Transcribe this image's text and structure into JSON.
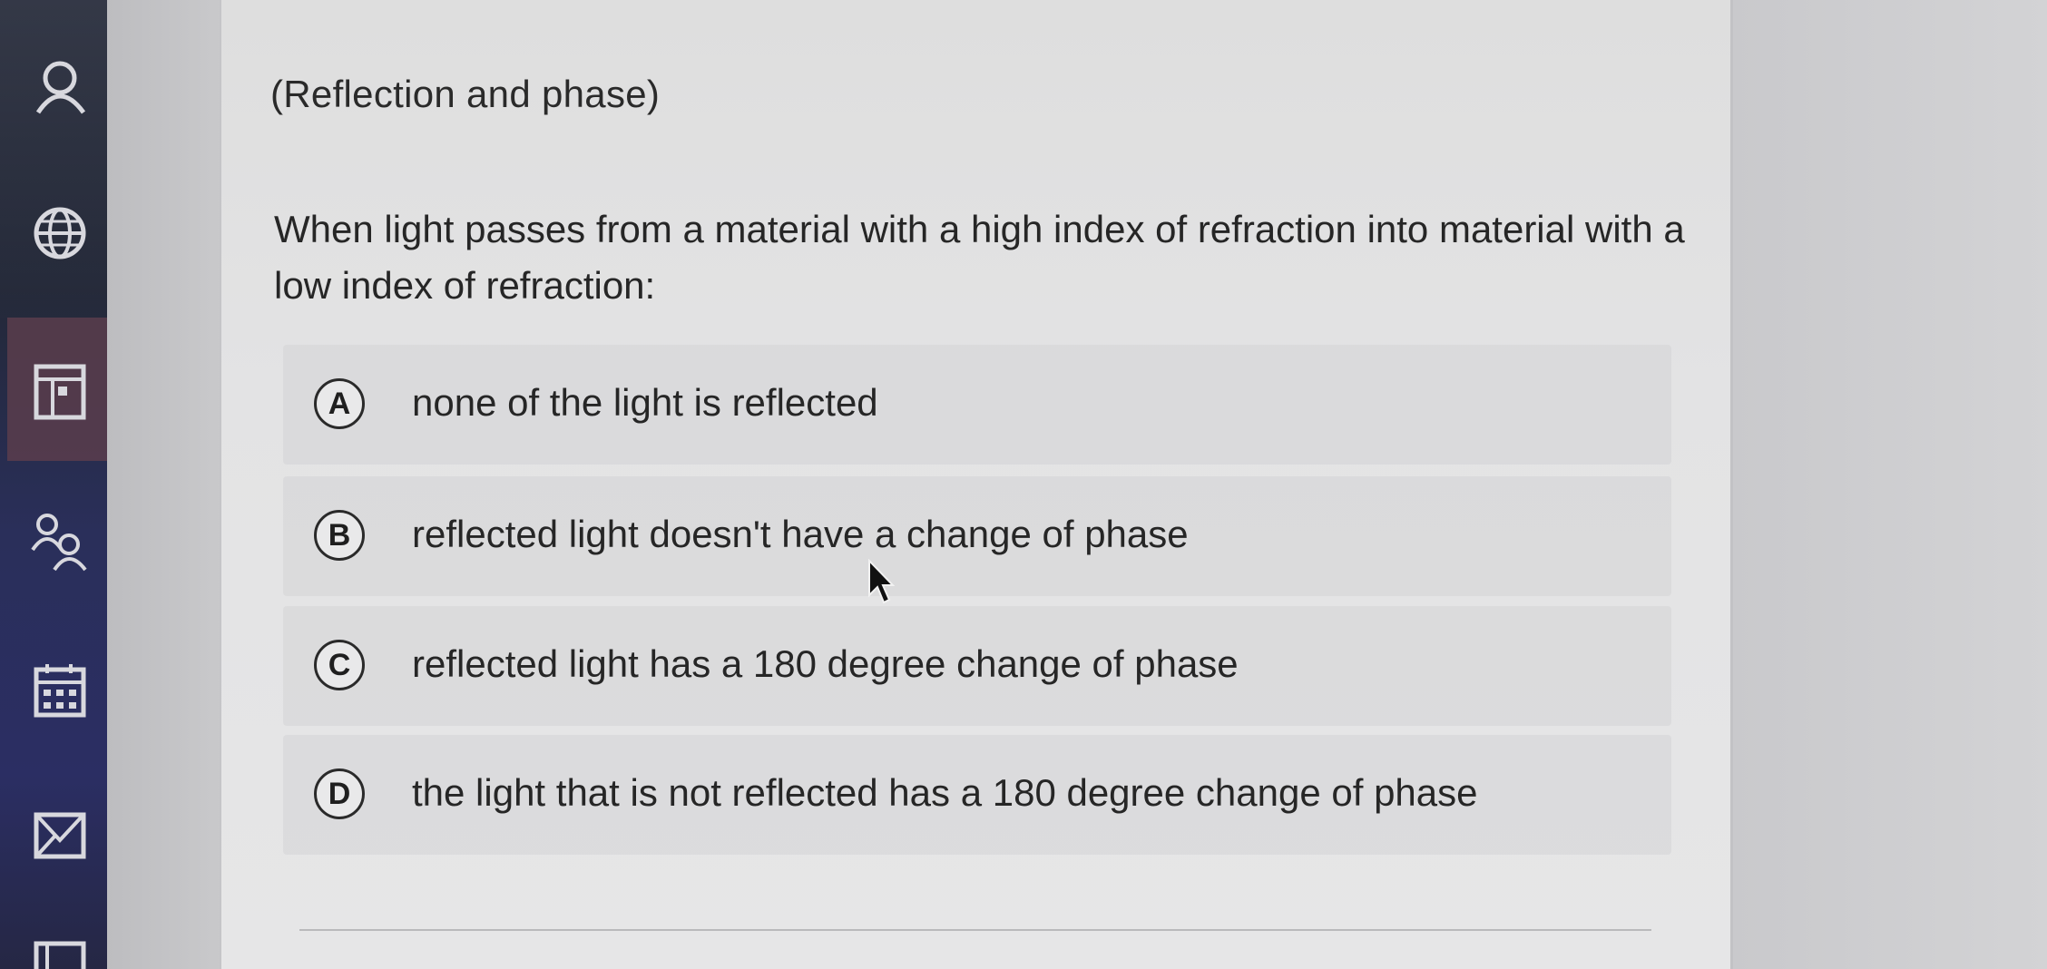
{
  "question": {
    "title": "(Reflection and phase)",
    "prompt": "When light passes from a material with a high index of refraction into material with a low index of refraction:"
  },
  "options": [
    {
      "letter": "A",
      "text": "none of the light is reflected"
    },
    {
      "letter": "B",
      "text": "reflected light doesn't have a change of phase"
    },
    {
      "letter": "C",
      "text": "reflected light has a 180 degree change of phase"
    },
    {
      "letter": "D",
      "text": "the light that is not reflected has a 180 degree change of phase"
    }
  ],
  "rail": {
    "icons": [
      "profile-icon",
      "globe-icon",
      "gradebook-icon",
      "people-icon",
      "calendar-icon",
      "inbox-icon",
      "courses-icon"
    ]
  },
  "colors": {
    "rail": "#232838",
    "rail_active": "#5a3d4c",
    "panel": "#e3e3e4",
    "text": "#262626"
  }
}
